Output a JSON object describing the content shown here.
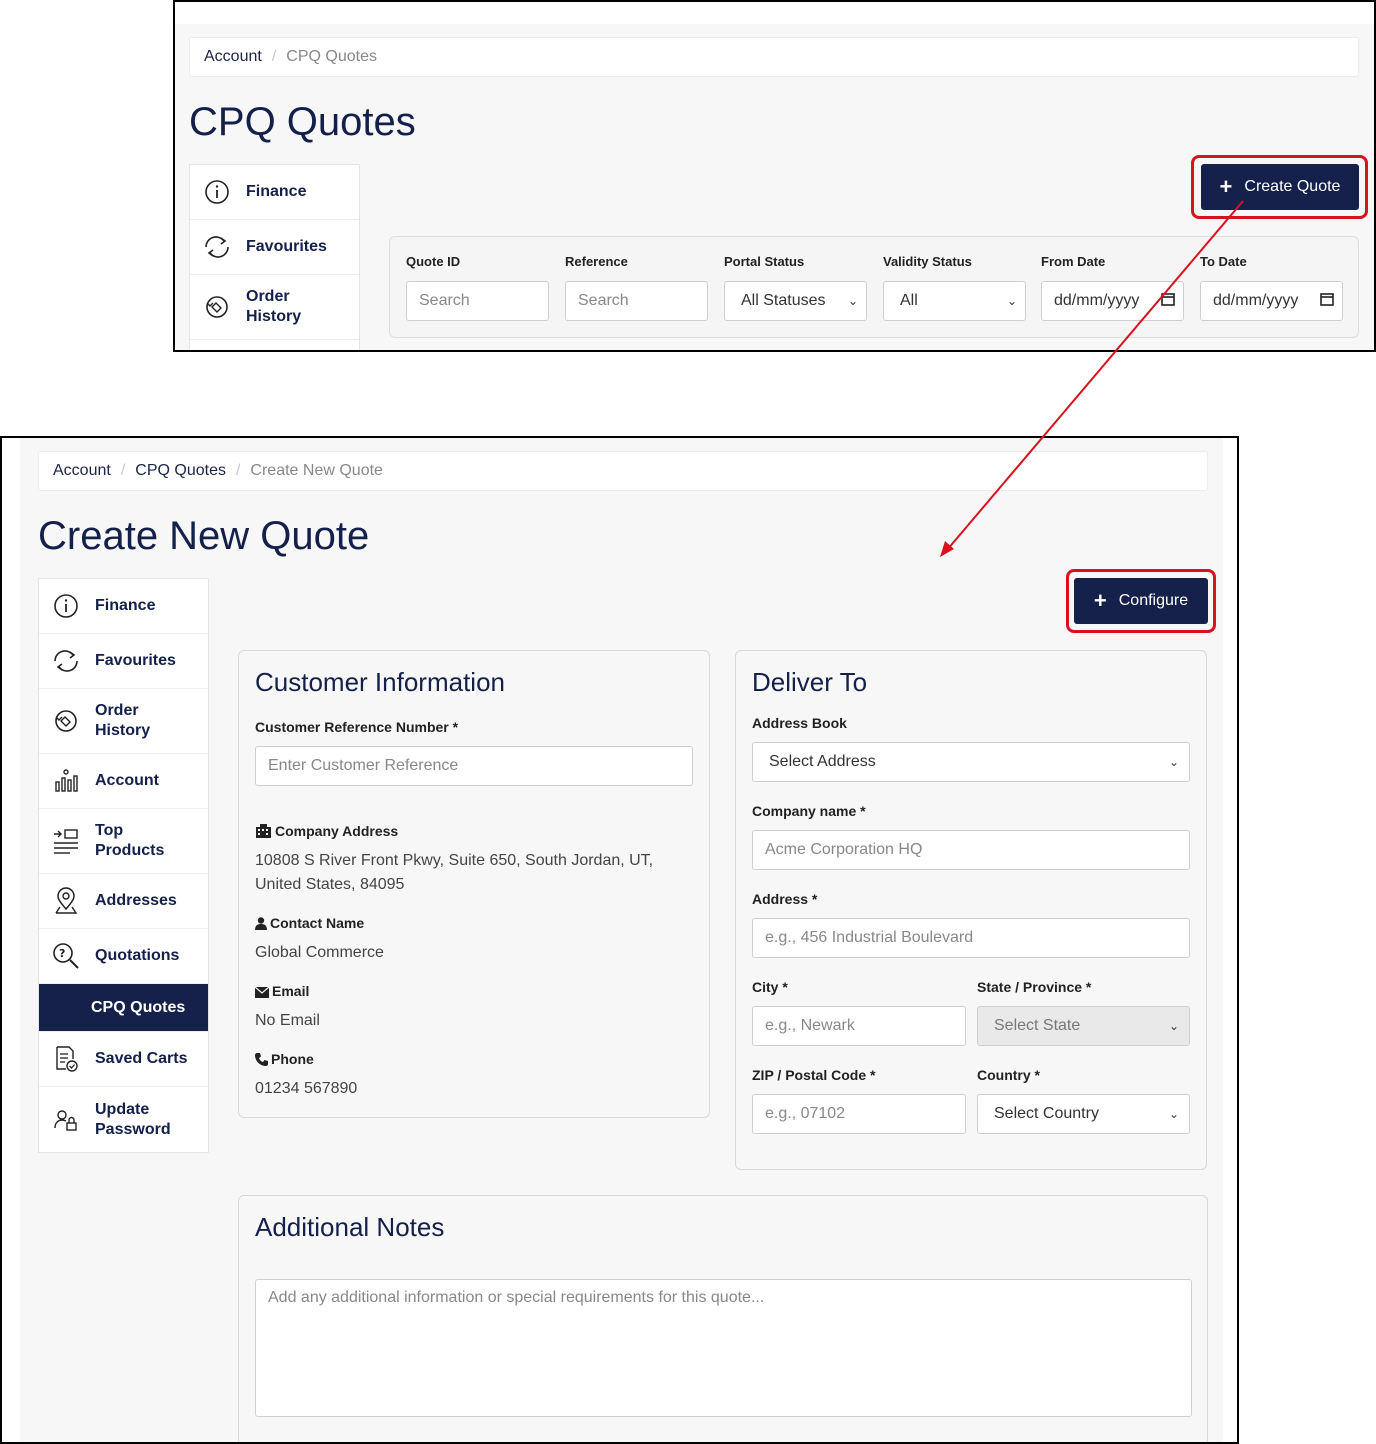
{
  "top_screen": {
    "breadcrumb": {
      "account": "Account",
      "current": "CPQ Quotes"
    },
    "title": "CPQ Quotes",
    "sidebar": [
      {
        "label": "Finance",
        "icon": "info-icon"
      },
      {
        "label": "Favourites",
        "icon": "refresh-icon"
      },
      {
        "label": "Order History",
        "icon": "order-history-icon"
      }
    ],
    "create_button": "Create Quote",
    "filters": {
      "quote_id_label": "Quote ID",
      "quote_id_placeholder": "Search",
      "reference_label": "Reference",
      "reference_placeholder": "Search",
      "portal_status_label": "Portal Status",
      "portal_status_value": "All Statuses",
      "validity_status_label": "Validity Status",
      "validity_status_value": "All",
      "from_date_label": "From Date",
      "from_date_value": "dd/mm/yyyy",
      "to_date_label": "To Date",
      "to_date_value": "dd/mm/yyyy"
    }
  },
  "bottom_screen": {
    "breadcrumb": {
      "account": "Account",
      "cpq": "CPQ Quotes",
      "current": "Create New Quote"
    },
    "title": "Create New Quote",
    "sidebar": [
      {
        "label": "Finance",
        "icon": "info-icon"
      },
      {
        "label": "Favourites",
        "icon": "refresh-icon"
      },
      {
        "label": "Order History",
        "icon": "order-history-icon"
      },
      {
        "label": "Account",
        "icon": "account-chart-icon"
      },
      {
        "label": "Top Products",
        "icon": "top-products-icon"
      },
      {
        "label": "Addresses",
        "icon": "location-pin-icon"
      },
      {
        "label": "Quotations",
        "icon": "quotation-search-icon"
      },
      {
        "label": "CPQ Quotes",
        "icon": ""
      },
      {
        "label": "Saved Carts",
        "icon": "saved-carts-icon"
      },
      {
        "label": "Update Password",
        "icon": "user-lock-icon"
      }
    ],
    "configure_button": "Configure",
    "customer": {
      "title": "Customer Information",
      "ref_label": "Customer Reference Number *",
      "ref_placeholder": "Enter Customer Reference",
      "company_address_label": "Company Address",
      "company_address": "10808 S River Front Pkwy, Suite 650, South Jordan, UT, United States, 84095",
      "contact_label": "Contact Name",
      "contact": "Global Commerce",
      "email_label": "Email",
      "email": "No Email",
      "phone_label": "Phone",
      "phone": "01234 567890"
    },
    "deliver": {
      "title": "Deliver To",
      "address_book_label": "Address Book",
      "address_book_value": "Select Address",
      "company_label": "Company name *",
      "company_placeholder": "Acme Corporation HQ",
      "address_label": "Address *",
      "address_placeholder": "e.g., 456 Industrial Boulevard",
      "city_label": "City *",
      "city_placeholder": "e.g., Newark",
      "state_label": "State / Province *",
      "state_value": "Select State",
      "zip_label": "ZIP / Postal Code *",
      "zip_placeholder": "e.g., 07102",
      "country_label": "Country *",
      "country_value": "Select Country"
    },
    "notes": {
      "title": "Additional Notes",
      "placeholder": "Add any additional information or special requirements for this quote..."
    }
  },
  "colors": {
    "navy": "#15214a",
    "highlight_red": "#d8121e"
  }
}
